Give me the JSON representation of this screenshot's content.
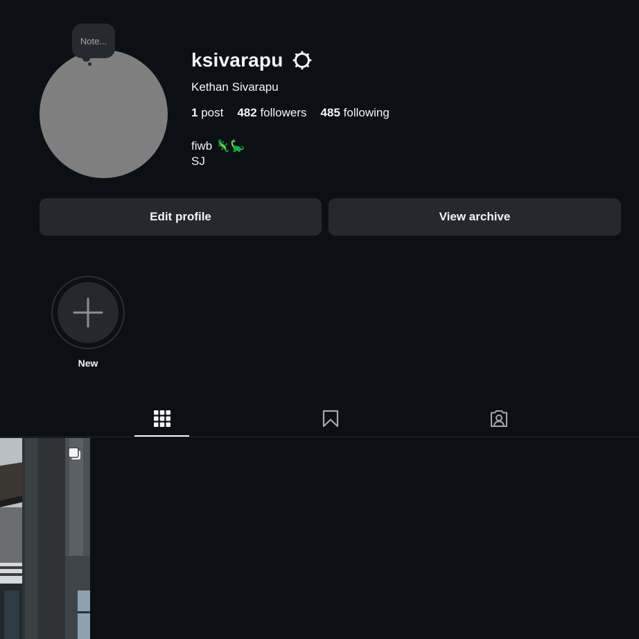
{
  "profile": {
    "username": "ksivarapu",
    "full_name": "Kethan Sivarapu",
    "note_placeholder": "Note...",
    "stats": {
      "posts_count": "1",
      "posts_label": "post",
      "followers_count": "482",
      "followers_label": "followers",
      "following_count": "485",
      "following_label": "following"
    },
    "bio": {
      "line1": "fiwb 🦎🦕",
      "line2": "SJ"
    }
  },
  "actions": {
    "edit_profile": "Edit profile",
    "view_archive": "View archive"
  },
  "highlights": {
    "new_label": "New"
  },
  "tabs": [
    {
      "name": "posts",
      "icon": "grid-icon",
      "active": true
    },
    {
      "name": "saved",
      "icon": "bookmark-icon",
      "active": false
    },
    {
      "name": "tagged",
      "icon": "tagged-person-icon",
      "active": false
    }
  ],
  "posts": [
    {
      "type": "carousel",
      "icon": "multiple-photos-icon"
    }
  ],
  "colors": {
    "background": "#0c1014",
    "button": "#25292e",
    "avatar_placeholder": "#7f7f7f",
    "text": "#f5f5f5"
  }
}
